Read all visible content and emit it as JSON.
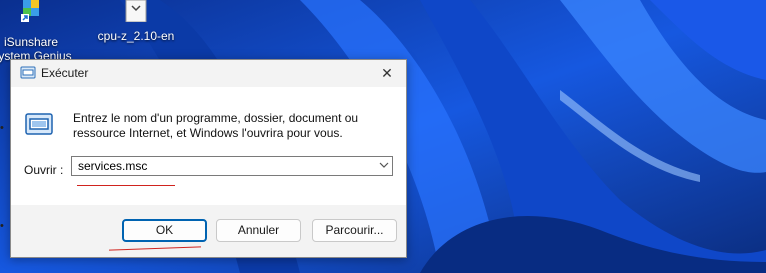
{
  "desktop": {
    "icons": [
      {
        "label_line1": "iSunshare",
        "label_line2": "System Genius"
      },
      {
        "label_line1": "cpu-z_2.10-en",
        "label_line2": ""
      }
    ]
  },
  "dialog": {
    "title": "Exécuter",
    "close_symbol": "✕",
    "description": "Entrez le nom d'un programme, dossier, document ou ressource Internet, et Windows l'ouvrira pour vous.",
    "open_label": "Ouvrir :",
    "input_value": "services.msc",
    "buttons": {
      "ok": "OK",
      "cancel": "Annuler",
      "browse": "Parcourir..."
    }
  },
  "icons": {
    "title": "run-icon",
    "body": "run-icon-large",
    "dropdown": "chevron-down-icon",
    "desktop_1": "isunshare-app-icon",
    "desktop_2": "file-icon"
  },
  "colors": {
    "wallpaper_blue": "#0d3fb8",
    "annotation_red": "#d0231e",
    "ok_focus": "#0063b1"
  }
}
